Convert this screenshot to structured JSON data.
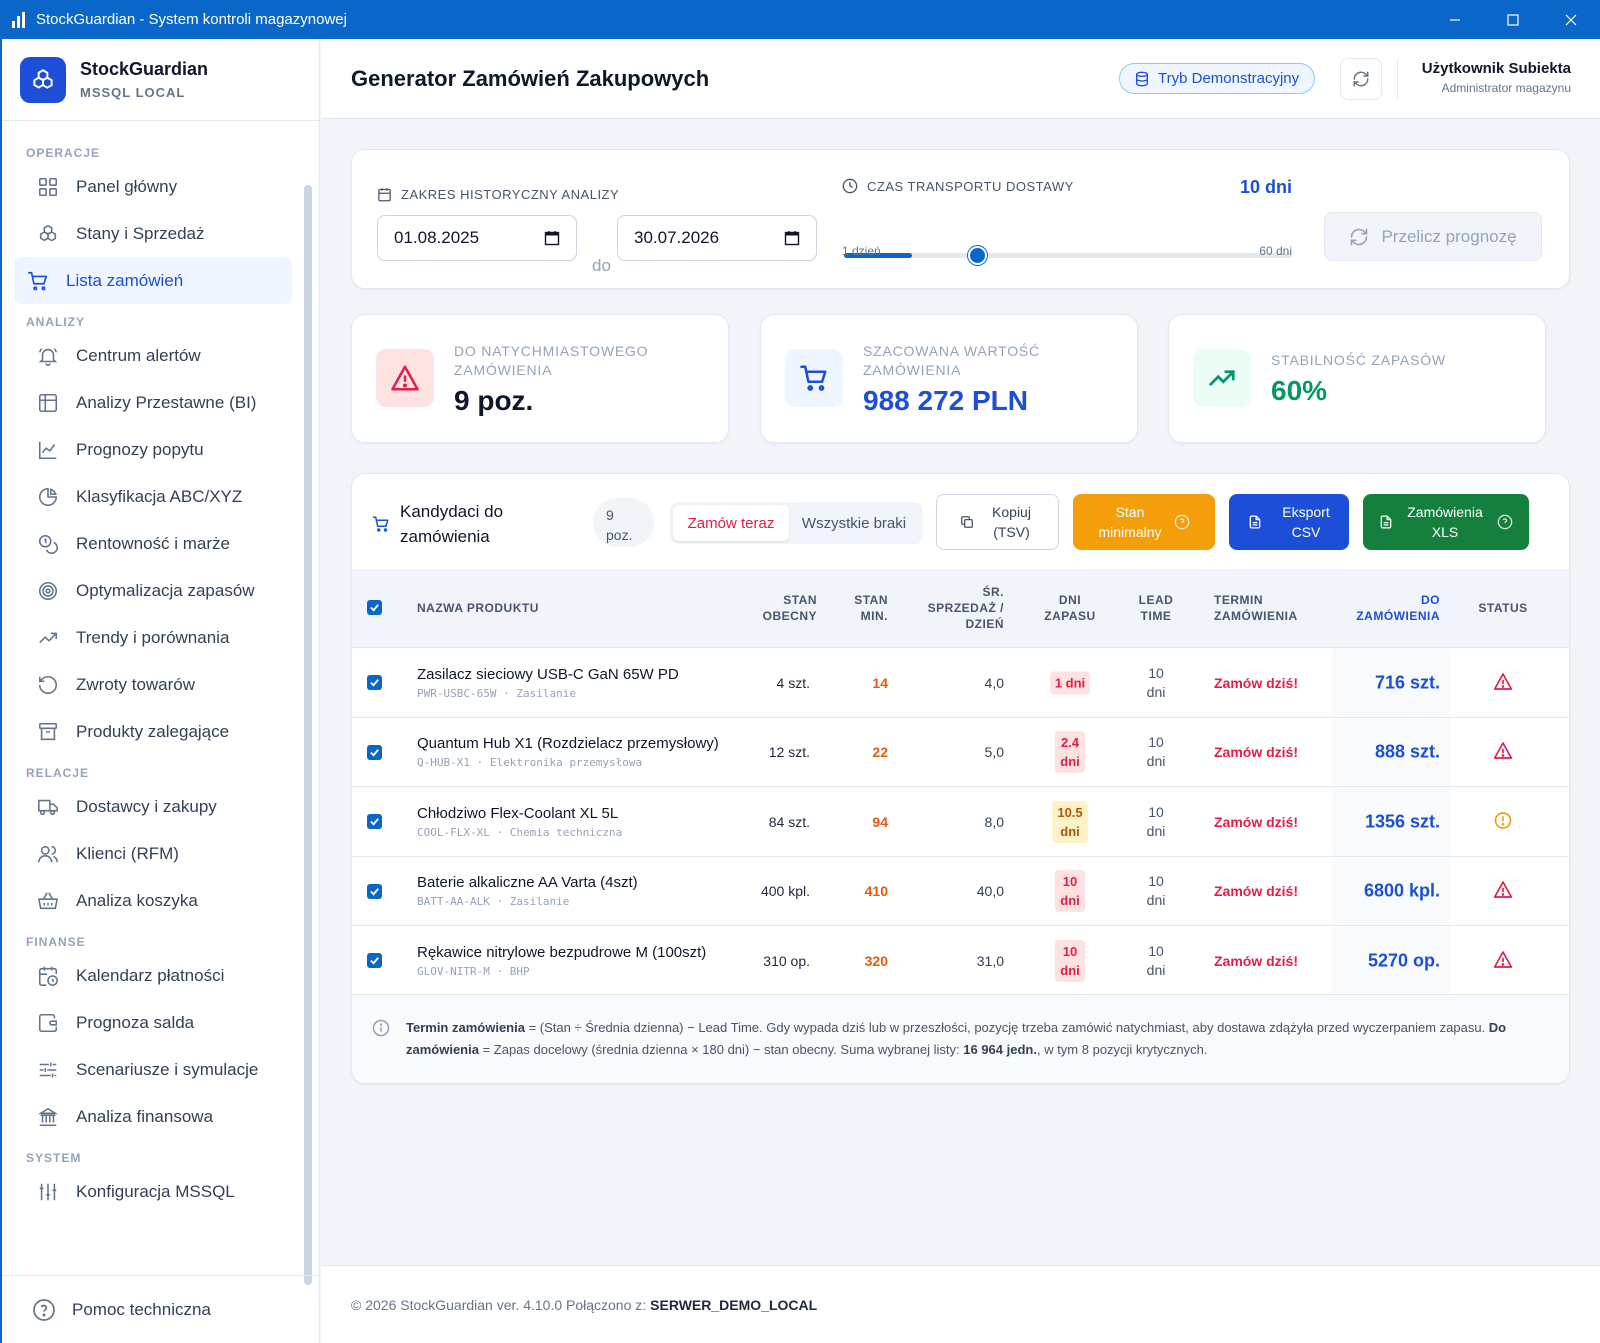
{
  "window": {
    "title": "StockGuardian - System kontroli magazynowej"
  },
  "brand": {
    "name": "StockGuardian",
    "sub": "MSSQL LOCAL"
  },
  "nav": {
    "sections": {
      "operacje": "OPERACJE",
      "analizy": "ANALIZY",
      "relacje": "RELACJE",
      "finanse": "FINANSE",
      "system": "SYSTEM"
    },
    "items": {
      "panel": "Panel główny",
      "stany": "Stany i Sprzedaż",
      "lista": "Lista zamówień",
      "alerty": "Centrum alertów",
      "bi": "Analizy Przestawne (BI)",
      "prognozy": "Prognozy popytu",
      "abc": "Klasyfikacja ABC/XYZ",
      "rentownosc": "Rentowność i marże",
      "optymalizacja": "Optymalizacja zapasów",
      "trendy": "Trendy i porównania",
      "zwroty": "Zwroty towarów",
      "zalegajace": "Produkty zalegające",
      "dostawcy": "Dostawcy i zakupy",
      "klienci": "Klienci (RFM)",
      "koszyk": "Analiza koszyka",
      "kalendarz": "Kalendarz płatności",
      "saldo": "Prognoza salda",
      "scenariusze": "Scenariusze i symulacje",
      "finansowa": "Analiza finansowa",
      "mssql": "Konfiguracja MSSQL"
    },
    "help": "Pomoc techniczna"
  },
  "header": {
    "title": "Generator Zamówień Zakupowych",
    "demo": "Tryb Demonstracyjny",
    "user_name": "Użytkownik Subiekta",
    "user_role": "Administrator magazynu"
  },
  "params": {
    "range_label": "ZAKRES HISTORYCZNY ANALIZY",
    "date_from": "01.08.2025",
    "to_word": "do",
    "date_to": "30.07.2026",
    "transport_label": "CZAS TRANSPORTU DOSTAWY",
    "transport_value": "10 dni",
    "transport_days": 10,
    "slider_min": 1,
    "slider_max": 60,
    "min_label": "1 dzień",
    "max_label": "60 dni",
    "recalc": "Przelicz prognozę"
  },
  "kpis": {
    "immediate_label": "DO NATYCHMIASTOWEGO ZAMÓWIENIA",
    "immediate_value": "9 poz.",
    "value_label": "SZACOWANA WARTOŚĆ ZAMÓWIENIA",
    "value_value": "988 272 PLN",
    "stability_label": "STABILNOŚĆ ZAPASÓW",
    "stability_value": "60%"
  },
  "table": {
    "title": "Kandydaci do zamówienia",
    "count_num": "9",
    "count_unit": "poz.",
    "seg_now": "Zamów teraz",
    "seg_all": "Wszystkie braki",
    "btn_copy_1": "Kopiuj",
    "btn_copy_2": "(TSV)",
    "btn_min_1": "Stan",
    "btn_min_2": "minimalny",
    "btn_csv_1": "Eksport",
    "btn_csv_2": "CSV",
    "btn_xls_1": "Zamówienia",
    "btn_xls_2": "XLS",
    "colors": {
      "orange": "#f59e0b",
      "blue": "#1d4ed8",
      "green": "#15803d"
    },
    "columns": {
      "name": "NAZWA PRODUKTU",
      "stock_1": "STAN",
      "stock_2": "OBECNY",
      "min_1": "STAN",
      "min_2": "MIN.",
      "avg_1": "ŚR.",
      "avg_2": "SPRZEDAŻ /",
      "avg_3": "DZIEŃ",
      "days_1": "DNI",
      "days_2": "ZAPASU",
      "lead_1": "LEAD",
      "lead_2": "TIME",
      "term_1": "TERMIN",
      "term_2": "ZAMÓWIENIA",
      "order_1": "DO",
      "order_2": "ZAMÓWIENIA",
      "status": "STATUS"
    },
    "rows": [
      {
        "name": "Zasilacz sieciowy USB-C GaN 65W PD",
        "sku": "PWR-USBC-65W · Zasilanie",
        "stock": "4 szt.",
        "min": "14",
        "avg": "4,0",
        "days_1": "1 dni",
        "days_2": "",
        "lead_1": "10",
        "lead_2": "dni",
        "term": "Zamów dziś!",
        "order": "716 szt.",
        "status": "alert-triangle-icon"
      },
      {
        "name": "Quantum Hub X1 (Rozdzielacz przemysłowy)",
        "sku": "Q-HUB-X1 · Elektronika przemysłowa",
        "stock": "12 szt.",
        "min": "22",
        "avg": "5,0",
        "days_1": "2.4",
        "days_2": "dni",
        "lead_1": "10",
        "lead_2": "dni",
        "term": "Zamów dziś!",
        "order": "888 szt.",
        "status": "alert-triangle-icon"
      },
      {
        "name": "Chłodziwo Flex-Coolant XL 5L",
        "sku": "COOL-FLX-XL · Chemia techniczna",
        "stock": "84 szt.",
        "min": "94",
        "avg": "8,0",
        "days_1": "10.5",
        "days_2": "dni",
        "lead_1": "10",
        "lead_2": "dni",
        "term": "Zamów dziś!",
        "order": "1356 szt.",
        "status": "alert-circle-icon"
      },
      {
        "name": "Baterie alkaliczne AA Varta (4szt)",
        "sku": "BATT-AA-ALK · Zasilanie",
        "stock": "400 kpl.",
        "min": "410",
        "avg": "40,0",
        "days_1": "10",
        "days_2": "dni",
        "lead_1": "10",
        "lead_2": "dni",
        "term": "Zamów dziś!",
        "order": "6800 kpl.",
        "status": "alert-triangle-icon"
      },
      {
        "name": "Rękawice nitrylowe bezpudrowe M (100szt)",
        "sku": "GLOV-NITR-M · BHP",
        "stock": "310 op.",
        "min": "320",
        "avg": "31,0",
        "days_1": "10",
        "days_2": "dni",
        "lead_1": "10",
        "lead_2": "dni",
        "term": "Zamów dziś!",
        "order": "5270 op.",
        "status": "alert-triangle-icon"
      }
    ],
    "note": {
      "b1": "Termin zamówienia",
      "t1": " = (Stan ÷ Średnia dzienna) − Lead Time. Gdy wypada dziś lub w przeszłości, pozycję trzeba zamówić natychmiast, aby dostawa zdążyła przed wyczerpaniem zapasu. ",
      "b2": "Do zamówienia",
      "t2": " = Zapas docelowy (średnia dzienna × 180 dni) − stan obecny. Suma wybranej listy: ",
      "b3": "16 964 jedn.",
      "t3": ", w tym 8 pozycji krytycznych."
    }
  },
  "footer": {
    "text": "© 2026 StockGuardian ver. 4.10.0 Połączono z:",
    "server": "SERWER_DEMO_LOCAL"
  }
}
